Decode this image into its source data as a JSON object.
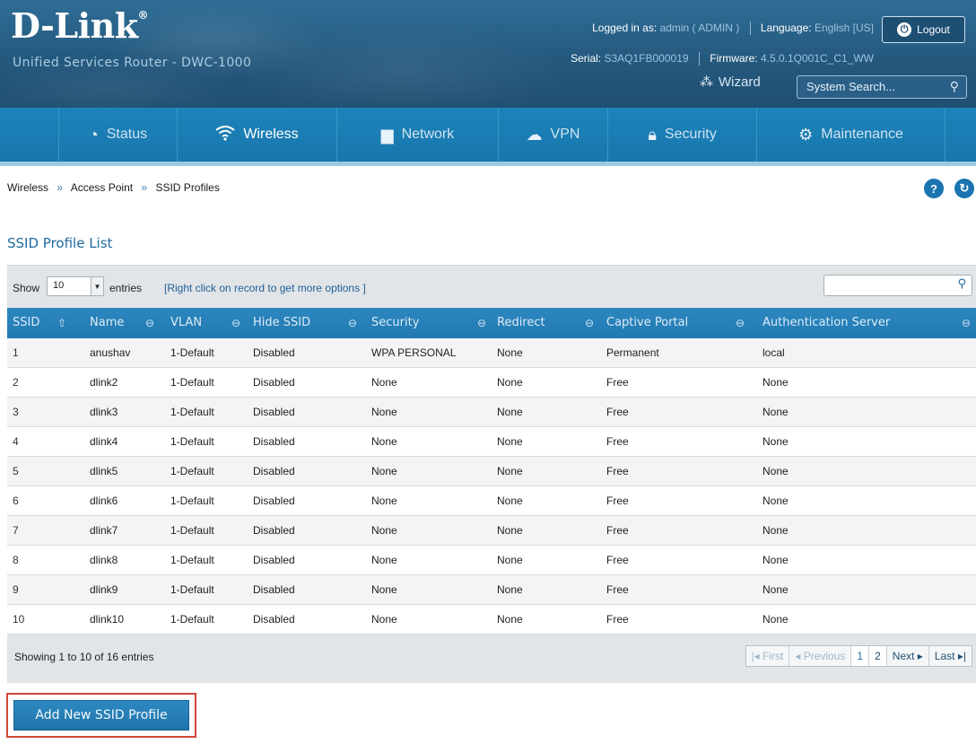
{
  "header": {
    "logo_text": "D-Link",
    "logo_reg": "®",
    "product": "Unified Services Router - DWC-1000",
    "logged_in_label": "Logged in as:",
    "logged_in_value": "admin ( ADMIN )",
    "language_label": "Language:",
    "language_value": "English [US]",
    "logout_label": "Logout",
    "serial_label": "Serial:",
    "serial_value": "S3AQ1FB000019",
    "firmware_label": "Firmware:",
    "firmware_value": "4.5.0.1Q001C_C1_WW",
    "wizard_label": "Wizard",
    "search_placeholder": "System Search..."
  },
  "nav": {
    "items": [
      {
        "label": "Status",
        "icon": "gauge-icon",
        "active": false
      },
      {
        "label": "Wireless",
        "icon": "wifi-icon",
        "active": true
      },
      {
        "label": "Network",
        "icon": "monitor-icon",
        "active": false
      },
      {
        "label": "VPN",
        "icon": "cloud-lock-icon",
        "active": false
      },
      {
        "label": "Security",
        "icon": "lock-icon",
        "active": false
      },
      {
        "label": "Maintenance",
        "icon": "gears-icon",
        "active": false
      }
    ]
  },
  "breadcrumb": [
    "Wireless",
    "Access Point",
    "SSID Profiles"
  ],
  "breadcrumb_sep": "»",
  "section_title": "SSID Profile List",
  "toolbar": {
    "show_label": "Show",
    "entries_value": "10",
    "entries_label": "entries",
    "hint": "[Right click on record to get more options ]"
  },
  "table": {
    "columns": [
      "SSID",
      "Name",
      "VLAN",
      "Hide SSID",
      "Security",
      "Redirect",
      "Captive Portal",
      "Authentication Server"
    ],
    "rows": [
      [
        "1",
        "anushav",
        "1-Default",
        "Disabled",
        "WPA PERSONAL",
        "None",
        "Permanent",
        "local"
      ],
      [
        "2",
        "dlink2",
        "1-Default",
        "Disabled",
        "None",
        "None",
        "Free",
        "None"
      ],
      [
        "3",
        "dlink3",
        "1-Default",
        "Disabled",
        "None",
        "None",
        "Free",
        "None"
      ],
      [
        "4",
        "dlink4",
        "1-Default",
        "Disabled",
        "None",
        "None",
        "Free",
        "None"
      ],
      [
        "5",
        "dlink5",
        "1-Default",
        "Disabled",
        "None",
        "None",
        "Free",
        "None"
      ],
      [
        "6",
        "dlink6",
        "1-Default",
        "Disabled",
        "None",
        "None",
        "Free",
        "None"
      ],
      [
        "7",
        "dlink7",
        "1-Default",
        "Disabled",
        "None",
        "None",
        "Free",
        "None"
      ],
      [
        "8",
        "dlink8",
        "1-Default",
        "Disabled",
        "None",
        "None",
        "Free",
        "None"
      ],
      [
        "9",
        "dlink9",
        "1-Default",
        "Disabled",
        "None",
        "None",
        "Free",
        "None"
      ],
      [
        "10",
        "dlink10",
        "1-Default",
        "Disabled",
        "None",
        "None",
        "Free",
        "None"
      ]
    ]
  },
  "footer": {
    "showing": "Showing 1 to 10 of 16 entries",
    "pager": {
      "first": "First",
      "previous": "Previous",
      "page1": "1",
      "page2": "2",
      "next": "Next",
      "last": "Last"
    }
  },
  "add_button_label": "Add New SSID Profile",
  "colors": {
    "header_bg": "#24597e",
    "nav_bg": "#1d83ba",
    "table_header_bg": "#2179b2",
    "highlight_border": "#d2473a"
  }
}
